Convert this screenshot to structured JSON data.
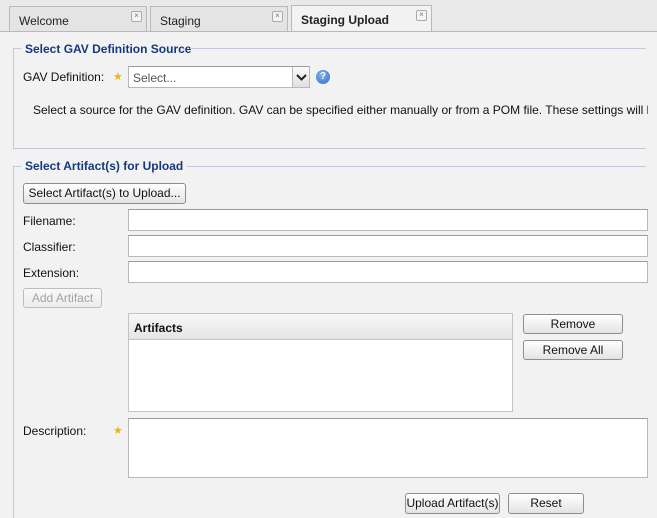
{
  "tabs": [
    {
      "label": "Welcome"
    },
    {
      "label": "Staging"
    },
    {
      "label": "Staging Upload"
    }
  ],
  "gav_section": {
    "legend": "Select GAV Definition Source",
    "gav_label": "GAV Definition:",
    "gav_placeholder": "Select...",
    "help_text": "Select a source for the GAV definition. GAV can be specified either manually or from a POM file. These settings will be applied"
  },
  "artifact_section": {
    "legend": "Select Artifact(s) for Upload",
    "select_button": "Select Artifact(s) to Upload...",
    "filename_label": "Filename:",
    "filename_value": "",
    "classifier_label": "Classifier:",
    "classifier_value": "",
    "extension_label": "Extension:",
    "extension_value": "",
    "add_button": "Add Artifact",
    "grid_header": "Artifacts",
    "remove_button": "Remove",
    "remove_all_button": "Remove All",
    "description_label": "Description:",
    "description_value": ""
  },
  "footer": {
    "upload_button": "Upload Artifact(s)",
    "reset_button": "Reset"
  },
  "colors": {
    "legend": "#16387c",
    "required_star": "#f2b400",
    "help_icon": "#2f6fc7"
  }
}
